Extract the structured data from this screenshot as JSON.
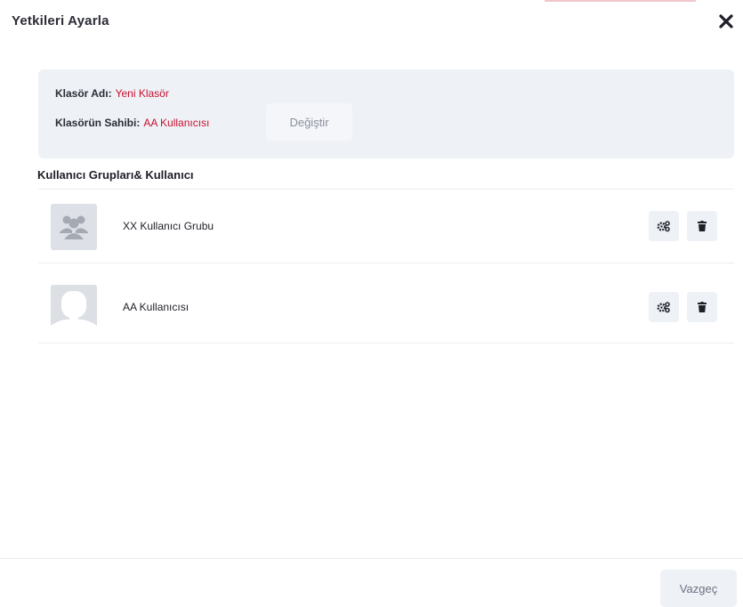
{
  "modal": {
    "title": "Yetkileri Ayarla",
    "close_icon": "close-icon"
  },
  "folder_info": {
    "name_label": "Klasör Adı:",
    "name_value": "Yeni Klasör",
    "owner_label": "Klasörün Sahibi:",
    "owner_value": "AA Kullanıcısı",
    "change_button": "Değiştir"
  },
  "permissions": {
    "section_title": "Kullanıcı Grupları& Kullanıcı",
    "entries": [
      {
        "name": "XX  Kullanıcı Grubu",
        "avatar_icon": "user-group-icon",
        "settings_icon": "gears-icon",
        "delete_icon": "trash-icon"
      },
      {
        "name": "AA Kullanıcısı",
        "avatar_icon": "user-placeholder-icon",
        "settings_icon": "gears-icon",
        "delete_icon": "trash-icon"
      }
    ]
  },
  "footer": {
    "cancel_button": "Vazgeç"
  },
  "colors": {
    "accent_red": "#c8102e",
    "panel_bg": "#eef1f6"
  }
}
